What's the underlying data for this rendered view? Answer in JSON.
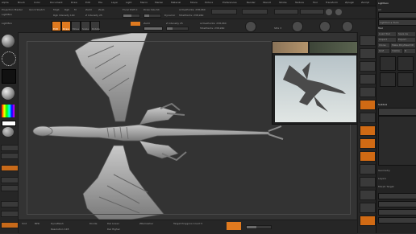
{
  "menubar": {
    "items": [
      "Alpha",
      "Brush",
      "Color",
      "Document",
      "Draw",
      "Edit",
      "File",
      "Layer",
      "Light",
      "Macro",
      "Marker",
      "Material",
      "Movie",
      "Picture",
      "Preferences",
      "Render",
      "Stencil",
      "Stroke",
      "Texture",
      "Tool",
      "Transform",
      "Zplugin",
      "Zscript"
    ]
  },
  "toolbar": {
    "projection_label": "Projection Master",
    "lightbox_label": "LightBox",
    "quick_sketch_label": "Quick Sketch",
    "edit_label": "Edit",
    "draw_label": "Draw",
    "move_label": "Move",
    "scale_label": "Scale",
    "rotate_label": "Rotate",
    "mrgb_label": "Mrgb",
    "rgb_label": "Rgb",
    "m_label": "M",
    "rgb_intensity_label": "Rgb Intensity 100",
    "zadd_label": "Zadd",
    "zsub_label": "Zsub",
    "z_intensity_label": "Z Intensity 25",
    "focal_shift_label": "Focal Shift 0",
    "draw_size_label": "Draw Size 64",
    "dynamic_label": "Dynamic",
    "active_points_label": "ActivePoints: 238,960",
    "total_points_label": "TotalPoints: 238,960",
    "bpr_label": "BPR",
    "spix_label": "SPix 3",
    "floor_label": "Floor",
    "local_label": "Local",
    "xyz_label": "Xyz",
    "frame_label": "Frame",
    "move_btn_label": "Move",
    "zoom3d_label": "Zoom3D",
    "rotate_btn_label": "Rotate",
    "polyf_label": "PolyF",
    "transp_label": "Transp",
    "solo_label": "Solo",
    "xpose_label": "Xpose"
  },
  "right_tray": {
    "title": "Lightbox",
    "tool_label": "Tool",
    "load_tool": "Load Tool",
    "save_as": "Save As",
    "import": "Import",
    "export": "Export",
    "clone": "Clone",
    "make_polymesh": "Make PolyMesh3D",
    "goz": "GoZ",
    "all": "All",
    "visible": "Visible",
    "r": "R",
    "lightbox_tools": "Lightbox ▸ Tools",
    "subtool_label": "Subtool",
    "geometry_label": "Geometry",
    "layers_label": "Layers",
    "morph_label": "Morph Target"
  },
  "bottombar": {
    "smt_label": "Smt",
    "bpr_label": "BPR",
    "dynamesh_label": "DynaMesh",
    "resolution_label": "Resolution 128",
    "zremesher_label": "ZRemesher",
    "target_label": "Target Polygons Count 5",
    "divide_label": "Divide",
    "del_lower": "Del Lower",
    "del_higher": "Del Higher"
  },
  "colors": {
    "accent": "#e07a1f",
    "background": "#2b2b2b",
    "viewport": "#333333"
  }
}
